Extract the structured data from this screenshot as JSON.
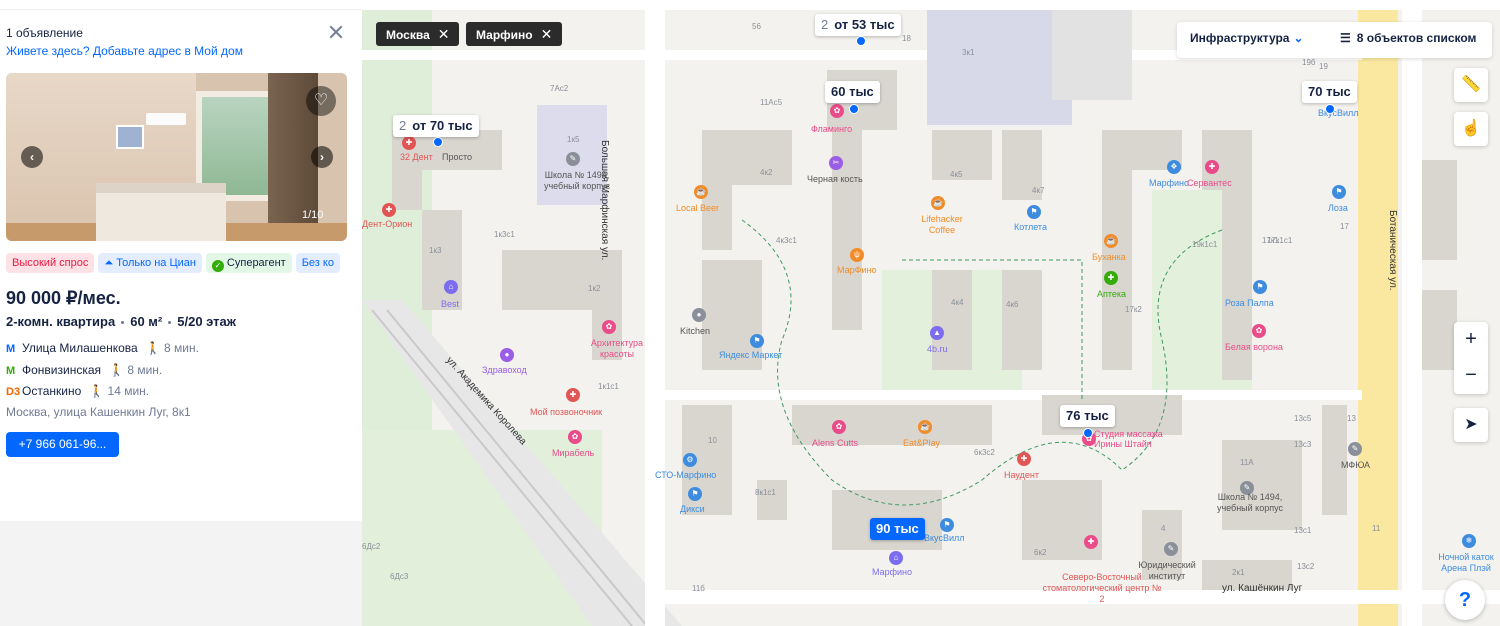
{
  "listing_panel": {
    "count": "1 объявление",
    "add_address": "Живете здесь? Добавьте адрес в Мой дом",
    "photo_counter": "1/10",
    "badges": [
      "Высокий спрос",
      "Только на Циан",
      "Суперагент",
      "Без ко"
    ],
    "price": "90 000 ₽/мес.",
    "rooms": "2-комн. квартира",
    "area": "60 м²",
    "floor": "5/20 этаж",
    "metro": [
      {
        "icon": "М",
        "name": "Улица Милашенкова",
        "walk": "8 мин."
      },
      {
        "icon": "М",
        "name": "Фонвизинская",
        "walk": "8 мин."
      },
      {
        "icon": "D3",
        "name": "Останкино",
        "walk": "14 мин."
      }
    ],
    "address": "Москва, улица Кашенкин Луг, 8к1",
    "phone": "+7 966 061-96..."
  },
  "map": {
    "filters": [
      {
        "label": "Москва"
      },
      {
        "label": "Марфино"
      }
    ],
    "infrastructure_label": "Инфраструктура",
    "list_label": "8 объектов списком",
    "zoom_in": "+",
    "zoom_out": "−",
    "help": "?",
    "price_pins": [
      {
        "count": "2",
        "label": "от 53 тыс"
      },
      {
        "count": "",
        "label": "60 тыс"
      },
      {
        "count": "2",
        "label": "от 70 тыс"
      },
      {
        "count": "",
        "label": "70 тыс"
      },
      {
        "count": "",
        "label": "76 тыс"
      },
      {
        "count": "",
        "label": "90 тыс"
      }
    ],
    "streets": [
      "Большая Марфинская ул.",
      "ул. Академика Королева",
      "Ботаническая ул.",
      "ул. Кашёнкин Луг"
    ],
    "pois": [
      "Фламинго",
      "32 Дент",
      "Просто",
      "Школа № 1494, учебный корпус",
      "Черная кость",
      "Local Beer",
      "Дент-Орион",
      "Best",
      "Здравоход",
      "Архитектура красоты",
      "Kitchen",
      "Яндекс Маркет",
      "МарФино",
      "Lifehacker Coffee",
      "Котлета",
      "4b.ru",
      "Марфино",
      "Сервантес",
      "Лоза",
      "Буханка",
      "Аптека",
      "Роза Палпа",
      "Белая ворона",
      "ВкусВилл",
      "Мой позвоночник",
      "Мирабель",
      "СТО-Марфино",
      "Дикси",
      "Alens Cutts",
      "Eat&Play",
      "Студия массажа Ирины Штайп",
      "Наудент",
      "ВкусВилл",
      "Марфино",
      "Северо-Восточный стоматологический центр № 2",
      "Юридический институт",
      "Школа № 1494, учебный корпус",
      "МФЮА",
      "Ночной каток Арена Плэй"
    ],
    "buildings": [
      "56",
      "18",
      "3к1",
      "19б",
      "19А",
      "19",
      "1к5",
      "7Ас2",
      "11Ас5",
      "4к2",
      "4к5",
      "4к7",
      "17к1",
      "17",
      "1к3",
      "1к3с1",
      "1к2",
      "4к3с1",
      "4к4",
      "4к6",
      "17к2",
      "19к1с1",
      "17к1с1",
      "1к1с1",
      "10",
      "8к1с1",
      "6к3с2",
      "6Дс2",
      "6Дс3",
      "11б",
      "6к2",
      "4",
      "11А",
      "13с5",
      "13с3",
      "13",
      "13с1",
      "11",
      "2к1",
      "13с2"
    ]
  }
}
